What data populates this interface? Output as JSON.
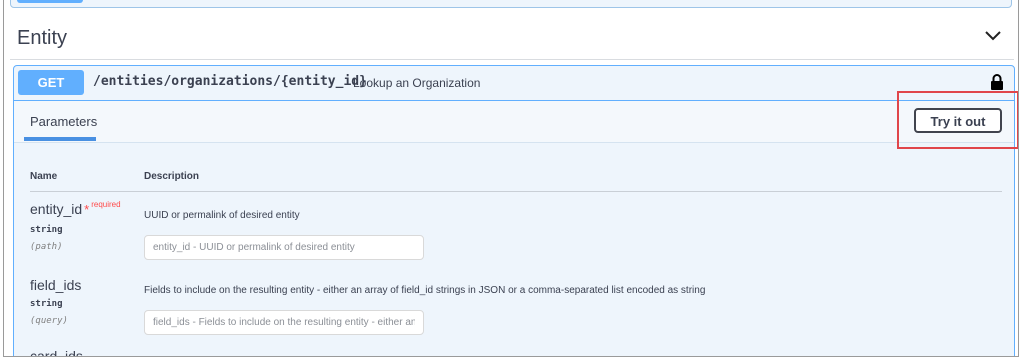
{
  "tag": {
    "title": "Entity"
  },
  "operation": {
    "method": "GET",
    "path": "/entities/organizations/{entity_id}",
    "summary": "Lookup an Organization"
  },
  "tabs": {
    "parameters": "Parameters"
  },
  "try_button": "Try it out",
  "table": {
    "name_header": "Name",
    "description_header": "Description"
  },
  "params": [
    {
      "name": "entity_id",
      "required_star": "*",
      "required_text": "required",
      "type": "string",
      "in": "(path)",
      "description": "UUID or permalink of desired entity",
      "placeholder": "entity_id - UUID or permalink of desired entity"
    },
    {
      "name": "field_ids",
      "type": "string",
      "in": "(query)",
      "description": "Fields to include on the resulting entity - either an array of field_id strings in JSON or a comma-separated list encoded as string",
      "placeholder": "field_ids - Fields to include on the resulting entity - either an a"
    },
    {
      "name": "card_ids"
    }
  ],
  "colors": {
    "get": "#61affe",
    "highlight": "#e0464b",
    "required": "#ff4b4b",
    "tab_underline": "#4990e2"
  },
  "icons": {
    "collapse": "chevron-down-icon",
    "auth": "lock-icon"
  }
}
